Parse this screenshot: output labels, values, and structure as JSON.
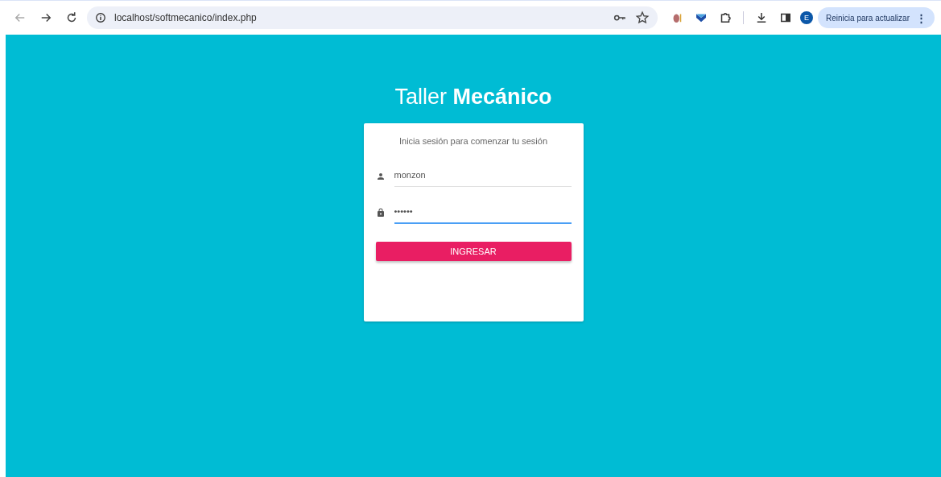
{
  "browser": {
    "url": "localhost/softmecanico/index.php",
    "profile_initial": "E",
    "update_button": "Reinicia para actualizar",
    "menu_glyph": "⋮"
  },
  "login": {
    "title": "Taller **Mecánico**",
    "subtitle": "Inicia sesión para comenzar tu sesión",
    "fields": [
      {
        "kind": "user",
        "value": "monzon",
        "focused": false
      },
      {
        "kind": "password",
        "value": "••••••",
        "focused": true
      }
    ],
    "submit": "INGRESAR"
  }
}
